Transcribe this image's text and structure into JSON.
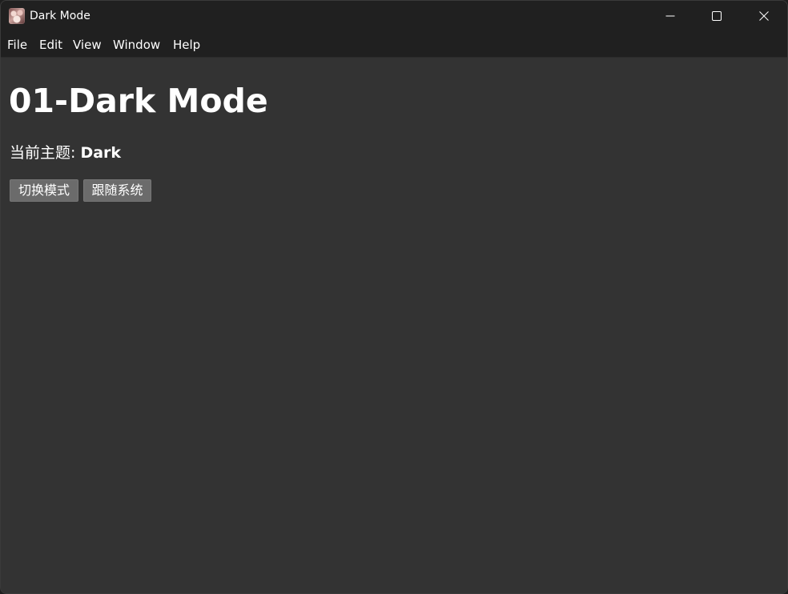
{
  "window": {
    "title": "Dark Mode",
    "icon": "app-icon"
  },
  "menu": {
    "items": [
      {
        "label": "File"
      },
      {
        "label": "Edit"
      },
      {
        "label": "View"
      },
      {
        "label": "Window"
      },
      {
        "label": "Help"
      }
    ]
  },
  "main": {
    "heading": "01-Dark Mode",
    "theme_label": "当前主题: ",
    "theme_value": "Dark",
    "buttons": {
      "toggle_label": "切换模式",
      "system_label": "跟随系统"
    }
  },
  "colors": {
    "background": "#333333",
    "titlebar": "#202020",
    "button": "#6b6b6b",
    "text": "#ffffff"
  }
}
